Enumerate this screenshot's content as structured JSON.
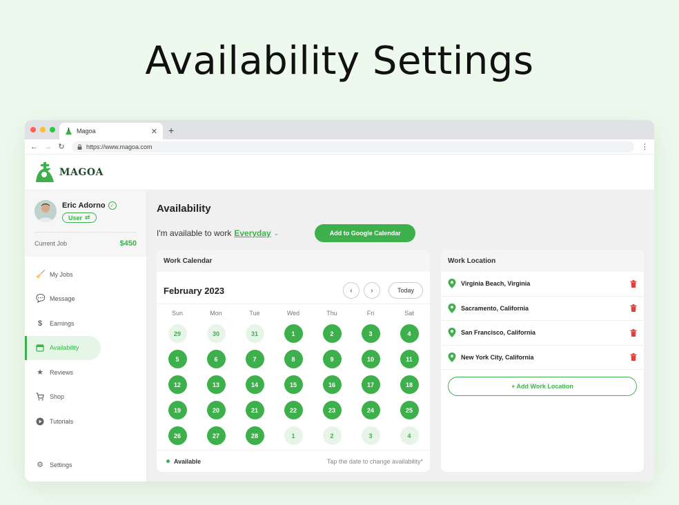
{
  "hero_title": "Availability Settings",
  "browser": {
    "tab_title": "Magoa",
    "url": "https://www.magoa.com"
  },
  "logo": {
    "name": "MAGOA"
  },
  "profile": {
    "name": "Eric Adorno",
    "role": "User",
    "current_job_label": "Current Job",
    "current_job_amount": "$450"
  },
  "sidebar": {
    "items": [
      {
        "label": "My Jobs",
        "icon": "broom-icon"
      },
      {
        "label": "Message",
        "icon": "chat-icon"
      },
      {
        "label": "Earnings",
        "icon": "dollar-icon"
      },
      {
        "label": "Availability",
        "icon": "calendar-icon"
      },
      {
        "label": "Reviews",
        "icon": "star-icon"
      },
      {
        "label": "Shop",
        "icon": "cart-icon"
      },
      {
        "label": "Tutorials",
        "icon": "play-icon"
      }
    ],
    "settings_label": "Settings"
  },
  "main": {
    "title": "Availability",
    "available_prefix": "I'm available to work",
    "available_value": "Everyday",
    "google_button": "Add to Google Calendar"
  },
  "calendar": {
    "header": "Work Calendar",
    "month": "February 2023",
    "today_label": "Today",
    "weekdays": [
      "Sun",
      "Mon",
      "Tue",
      "Wed",
      "Thu",
      "Fri",
      "Sat"
    ],
    "weeks": [
      [
        {
          "d": "29",
          "on": false
        },
        {
          "d": "30",
          "on": false
        },
        {
          "d": "31",
          "on": false
        },
        {
          "d": "1",
          "on": true
        },
        {
          "d": "2",
          "on": true
        },
        {
          "d": "3",
          "on": true
        },
        {
          "d": "4",
          "on": true
        }
      ],
      [
        {
          "d": "5",
          "on": true
        },
        {
          "d": "6",
          "on": true
        },
        {
          "d": "7",
          "on": true
        },
        {
          "d": "8",
          "on": true
        },
        {
          "d": "9",
          "on": true
        },
        {
          "d": "10",
          "on": true
        },
        {
          "d": "11",
          "on": true
        }
      ],
      [
        {
          "d": "12",
          "on": true
        },
        {
          "d": "13",
          "on": true
        },
        {
          "d": "14",
          "on": true
        },
        {
          "d": "15",
          "on": true
        },
        {
          "d": "16",
          "on": true
        },
        {
          "d": "17",
          "on": true
        },
        {
          "d": "18",
          "on": true
        }
      ],
      [
        {
          "d": "19",
          "on": true
        },
        {
          "d": "20",
          "on": true
        },
        {
          "d": "21",
          "on": true
        },
        {
          "d": "22",
          "on": true
        },
        {
          "d": "23",
          "on": true
        },
        {
          "d": "24",
          "on": true
        },
        {
          "d": "25",
          "on": true
        }
      ],
      [
        {
          "d": "26",
          "on": true
        },
        {
          "d": "27",
          "on": true
        },
        {
          "d": "28",
          "on": true
        },
        {
          "d": "1",
          "on": false
        },
        {
          "d": "2",
          "on": false
        },
        {
          "d": "3",
          "on": false
        },
        {
          "d": "4",
          "on": false
        }
      ]
    ],
    "legend_label": "Available",
    "hint": "Tap the date to change availability*"
  },
  "locations": {
    "header": "Work Location",
    "items": [
      "Virginia Beach, Virginia",
      "Sacramento, California",
      "San Francisco, California",
      "New York City, California"
    ],
    "add_label": "+ Add Work Location"
  },
  "colors": {
    "accent": "#3db04b",
    "accent_light": "#e6f5e8",
    "danger": "#e0413a",
    "page_bg": "#eef9ee"
  }
}
